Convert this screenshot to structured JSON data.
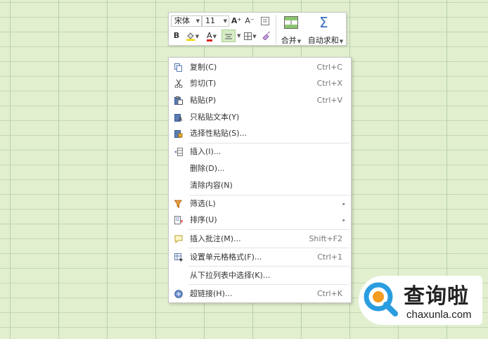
{
  "toolbar": {
    "font_name": "宋体",
    "font_size": "11",
    "grow_font_glyph": "A⁺",
    "shrink_font_glyph": "A⁻",
    "bold_glyph": "B",
    "font_color_glyph": "A",
    "merge_label": "合并",
    "autosum_label": "自动求和",
    "autosum_glyph": "Σ",
    "colors": {
      "fill_swatch": "#f5d300",
      "font_swatch": "#e02020",
      "sum_blue": "#3a6fc2"
    }
  },
  "menu": {
    "items": [
      {
        "label": "复制(C)",
        "shortcut": "Ctrl+C",
        "icon": "copy-icon"
      },
      {
        "label": "剪切(T)",
        "shortcut": "Ctrl+X",
        "icon": "scissors-icon"
      },
      {
        "label": "粘贴(P)",
        "shortcut": "Ctrl+V",
        "icon": "paste-icon"
      },
      {
        "label": "只粘贴文本(Y)",
        "shortcut": "",
        "icon": "paste-text-icon"
      },
      {
        "label": "选择性粘贴(S)...",
        "shortcut": "",
        "icon": "paste-special-icon"
      },
      {
        "label": "插入(I)...",
        "shortcut": "",
        "icon": "insert-icon"
      },
      {
        "label": "删除(D)...",
        "shortcut": "",
        "icon": ""
      },
      {
        "label": "清除内容(N)",
        "shortcut": "",
        "icon": ""
      },
      {
        "label": "筛选(L)",
        "shortcut": "",
        "icon": "filter-icon"
      },
      {
        "label": "排序(U)",
        "shortcut": "",
        "icon": "sort-icon"
      },
      {
        "label": "插入批注(M)...",
        "shortcut": "Shift+F2",
        "icon": "comment-icon"
      },
      {
        "label": "设置单元格格式(F)...",
        "shortcut": "Ctrl+1",
        "icon": "format-cells-icon"
      },
      {
        "label": "从下拉列表中选择(K)...",
        "shortcut": "",
        "icon": ""
      },
      {
        "label": "超链接(H)...",
        "shortcut": "Ctrl+K",
        "icon": "hyperlink-icon"
      }
    ],
    "submenu_glyph": "▸"
  },
  "watermark": {
    "title": "查询啦",
    "url": "chaxunla.com"
  }
}
